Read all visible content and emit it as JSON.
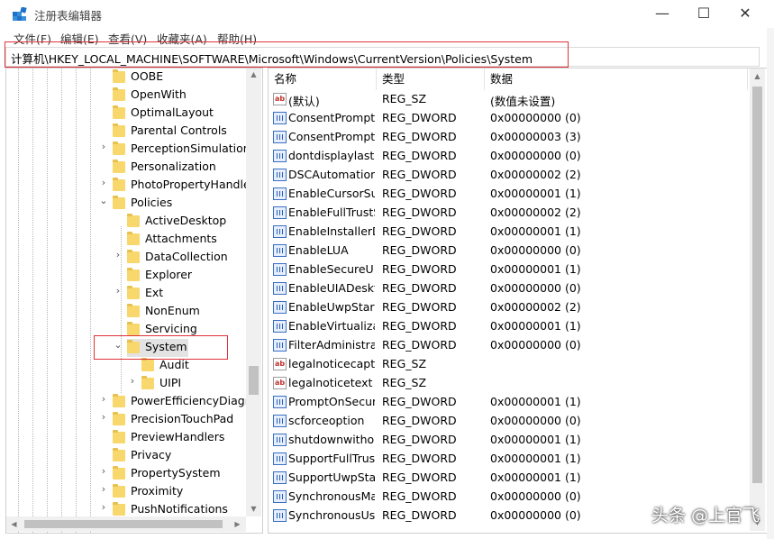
{
  "window": {
    "title": "注册表编辑器",
    "minimize_label": "—",
    "maximize_label": "☐",
    "close_label": "✕"
  },
  "menu": [
    "文件(F)",
    "编辑(E)",
    "查看(V)",
    "收藏夹(A)",
    "帮助(H)"
  ],
  "address": "计算机\\HKEY_LOCAL_MACHINE\\SOFTWARE\\Microsoft\\Windows\\CurrentVersion\\Policies\\System",
  "tree": [
    {
      "label": "OOBE",
      "level": 0,
      "expander": ""
    },
    {
      "label": "OpenWith",
      "level": 0,
      "expander": ""
    },
    {
      "label": "OptimalLayout",
      "level": 0,
      "expander": ""
    },
    {
      "label": "Parental Controls",
      "level": 0,
      "expander": ""
    },
    {
      "label": "PerceptionSimulationE",
      "level": 0,
      "expander": "›"
    },
    {
      "label": "Personalization",
      "level": 0,
      "expander": ""
    },
    {
      "label": "PhotoPropertyHandle",
      "level": 0,
      "expander": "›"
    },
    {
      "label": "Policies",
      "level": 0,
      "expander": "⌄"
    },
    {
      "label": "ActiveDesktop",
      "level": 1,
      "expander": ""
    },
    {
      "label": "Attachments",
      "level": 1,
      "expander": ""
    },
    {
      "label": "DataCollection",
      "level": 1,
      "expander": "›"
    },
    {
      "label": "Explorer",
      "level": 1,
      "expander": ""
    },
    {
      "label": "Ext",
      "level": 1,
      "expander": "›"
    },
    {
      "label": "NonEnum",
      "level": 1,
      "expander": ""
    },
    {
      "label": "Servicing",
      "level": 1,
      "expander": ""
    },
    {
      "label": "System",
      "level": 1,
      "expander": "⌄",
      "selected": true
    },
    {
      "label": "Audit",
      "level": 2,
      "expander": ""
    },
    {
      "label": "UIPI",
      "level": 2,
      "expander": "›"
    },
    {
      "label": "PowerEfficiencyDiagno",
      "level": 0,
      "expander": "›"
    },
    {
      "label": "PrecisionTouchPad",
      "level": 0,
      "expander": "›"
    },
    {
      "label": "PreviewHandlers",
      "level": 0,
      "expander": ""
    },
    {
      "label": "Privacy",
      "level": 0,
      "expander": ""
    },
    {
      "label": "PropertySystem",
      "level": 0,
      "expander": "›"
    },
    {
      "label": "Proximity",
      "level": 0,
      "expander": "›"
    },
    {
      "label": "PushNotifications",
      "level": 0,
      "expander": "›"
    }
  ],
  "columns": [
    "名称",
    "类型",
    "数据"
  ],
  "values": [
    {
      "icon": "string-value-icon",
      "name": "(默认)",
      "type": "REG_SZ",
      "data": "(数值未设置)"
    },
    {
      "icon": "dword-value-icon",
      "name": "ConsentPromptBehaviorAdmin",
      "type": "REG_DWORD",
      "data": "0x00000000 (0)"
    },
    {
      "icon": "dword-value-icon",
      "name": "ConsentPromptBehaviorUser",
      "type": "REG_DWORD",
      "data": "0x00000003 (3)"
    },
    {
      "icon": "dword-value-icon",
      "name": "dontdisplaylastusername",
      "type": "REG_DWORD",
      "data": "0x00000000 (0)"
    },
    {
      "icon": "dword-value-icon",
      "name": "DSCAutomationHostEnabled",
      "type": "REG_DWORD",
      "data": "0x00000002 (2)"
    },
    {
      "icon": "dword-value-icon",
      "name": "EnableCursorSuppression",
      "type": "REG_DWORD",
      "data": "0x00000001 (1)"
    },
    {
      "icon": "dword-value-icon",
      "name": "EnableFullTrustStartupTasks",
      "type": "REG_DWORD",
      "data": "0x00000002 (2)"
    },
    {
      "icon": "dword-value-icon",
      "name": "EnableInstallerDetection",
      "type": "REG_DWORD",
      "data": "0x00000001 (1)"
    },
    {
      "icon": "dword-value-icon",
      "name": "EnableLUA",
      "type": "REG_DWORD",
      "data": "0x00000000 (0)"
    },
    {
      "icon": "dword-value-icon",
      "name": "EnableSecureUIAPaths",
      "type": "REG_DWORD",
      "data": "0x00000001 (1)"
    },
    {
      "icon": "dword-value-icon",
      "name": "EnableUIADesktopToggle",
      "type": "REG_DWORD",
      "data": "0x00000000 (0)"
    },
    {
      "icon": "dword-value-icon",
      "name": "EnableUwpStartupTasks",
      "type": "REG_DWORD",
      "data": "0x00000002 (2)"
    },
    {
      "icon": "dword-value-icon",
      "name": "EnableVirtualization",
      "type": "REG_DWORD",
      "data": "0x00000001 (1)"
    },
    {
      "icon": "dword-value-icon",
      "name": "FilterAdministratorToken",
      "type": "REG_DWORD",
      "data": "0x00000000 (0)"
    },
    {
      "icon": "string-value-icon",
      "name": "legalnoticecaption",
      "type": "REG_SZ",
      "data": ""
    },
    {
      "icon": "string-value-icon",
      "name": "legalnoticetext",
      "type": "REG_SZ",
      "data": ""
    },
    {
      "icon": "dword-value-icon",
      "name": "PromptOnSecureDesktop",
      "type": "REG_DWORD",
      "data": "0x00000001 (1)"
    },
    {
      "icon": "dword-value-icon",
      "name": "scforceoption",
      "type": "REG_DWORD",
      "data": "0x00000000 (0)"
    },
    {
      "icon": "dword-value-icon",
      "name": "shutdownwithoutlogon",
      "type": "REG_DWORD",
      "data": "0x00000001 (1)"
    },
    {
      "icon": "dword-value-icon",
      "name": "SupportFullTrustStartupTasks",
      "type": "REG_DWORD",
      "data": "0x00000001 (1)"
    },
    {
      "icon": "dword-value-icon",
      "name": "SupportUwpStartupTasks",
      "type": "REG_DWORD",
      "data": "0x00000001 (1)"
    },
    {
      "icon": "dword-value-icon",
      "name": "SynchronousMachineGroupPolicy",
      "type": "REG_DWORD",
      "data": "0x00000000 (0)"
    },
    {
      "icon": "dword-value-icon",
      "name": "SynchronousUserGroupPolicy",
      "type": "REG_DWORD",
      "data": "0x00000000 (0)"
    }
  ],
  "watermark": "头条 @上官飞",
  "colors": {
    "highlight_border": "#e0323a",
    "folder": "#f8d76c",
    "selection": "#e3e3e3"
  }
}
